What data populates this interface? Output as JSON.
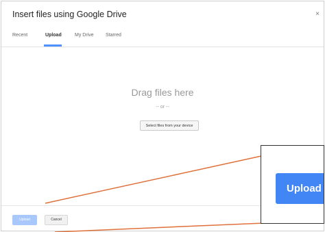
{
  "dialog": {
    "title": "Insert files using Google Drive",
    "close_symbol": "×"
  },
  "tabs": [
    {
      "label": "Recent",
      "active": false
    },
    {
      "label": "Upload",
      "active": true
    },
    {
      "label": "My Drive",
      "active": false
    },
    {
      "label": "Starred",
      "active": false
    }
  ],
  "drop": {
    "heading": "Drag files here",
    "or_text": "-- or --",
    "select_button_label": "Select files from your device"
  },
  "footer": {
    "upload_label": "Upload",
    "cancel_label": "Cancel"
  },
  "zoom": {
    "upload_label": "Upload"
  },
  "colors": {
    "accent": "#4285f4",
    "disabled_button": "#a8c7fa",
    "callout_line": "#e0703a"
  }
}
